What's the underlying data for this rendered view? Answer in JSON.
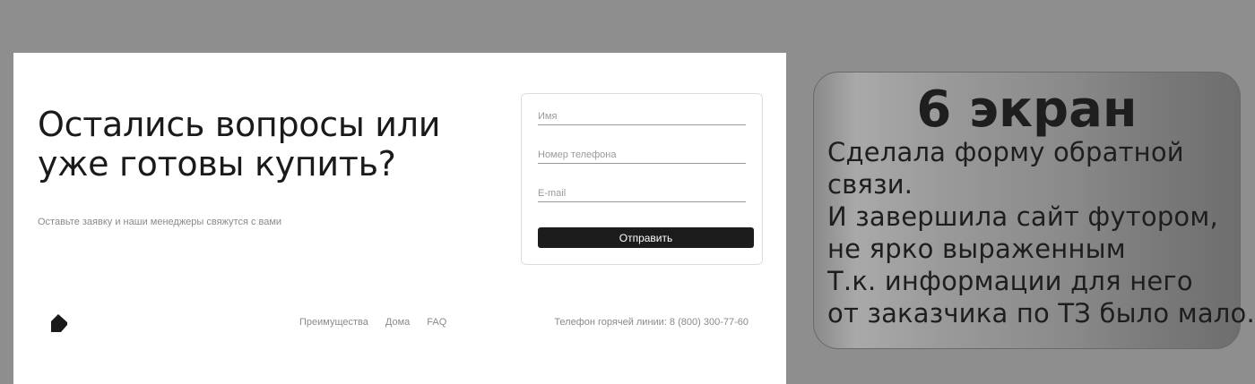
{
  "contact_section": {
    "headline_lines": [
      "Остались вопросы или",
      "уже готовы купить?"
    ],
    "subtitle": "Оставьте заявку и наши менеджеры свяжутся с вами"
  },
  "form": {
    "name_placeholder": "Имя",
    "phone_placeholder": "Номер телефона",
    "email_placeholder": "E-mail",
    "submit_label": "Отправить"
  },
  "footer": {
    "logo_icon": "house-icon",
    "nav": [
      "Преимущества",
      "Дома",
      "FAQ"
    ],
    "hotline": "Телефон горячей линии: 8 (800) 300-77-60"
  },
  "note": {
    "title": "6 экран",
    "lines": [
      "Сделала форму обратной",
      "связи.",
      "И завершила сайт футором,",
      "не ярко выраженным",
      "Т.к. информации для него",
      "от заказчика по ТЗ было мало."
    ]
  }
}
